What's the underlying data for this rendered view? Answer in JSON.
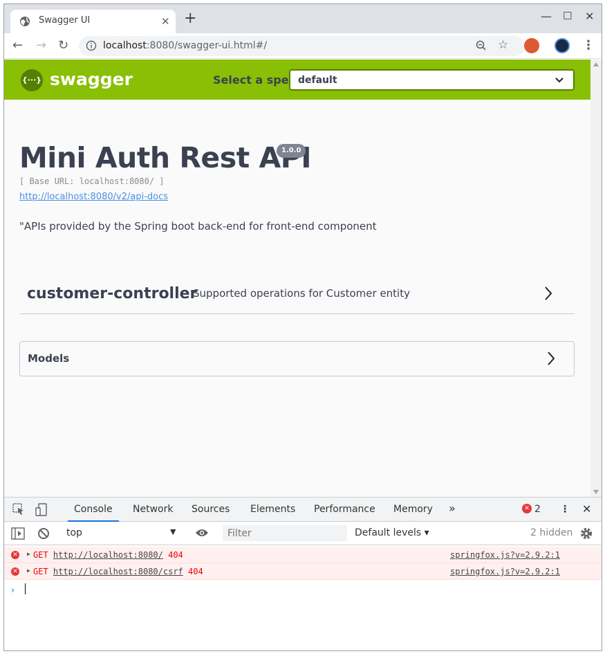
{
  "browser": {
    "tab_title": "Swagger UI",
    "url_host": "localhost",
    "url_rest": ":8080/swagger-ui.html#/"
  },
  "swagger": {
    "logo_text": "swagger",
    "spec_label": "Select a spec",
    "spec_value": "default",
    "api_title": "Mini Auth Rest API",
    "version": "1.0.0",
    "base_url": "[ Base URL: localhost:8080/ ]",
    "docs_link": "http://localhost:8080/v2/api-docs",
    "description": "\"APIs provided by the Spring boot back-end for front-end component",
    "tag_name": "customer-controller",
    "tag_description": "Supported operations for Customer entity",
    "models_label": "Models",
    "accent_color": "#89bf04"
  },
  "devtools": {
    "tabs": [
      "Console",
      "Network",
      "Sources",
      "Elements",
      "Performance",
      "Memory"
    ],
    "more": "»",
    "error_count": "2",
    "context": "top",
    "filter_placeholder": "Filter",
    "levels": "Default levels",
    "hidden": "2 hidden",
    "errors": [
      {
        "method": "GET",
        "url": "http://localhost:8080/",
        "status": "404",
        "source": "springfox.js?v=2.9.2:1"
      },
      {
        "method": "GET",
        "url": "http://localhost:8080/csrf",
        "status": "404",
        "source": "springfox.js?v=2.9.2:1"
      }
    ]
  }
}
